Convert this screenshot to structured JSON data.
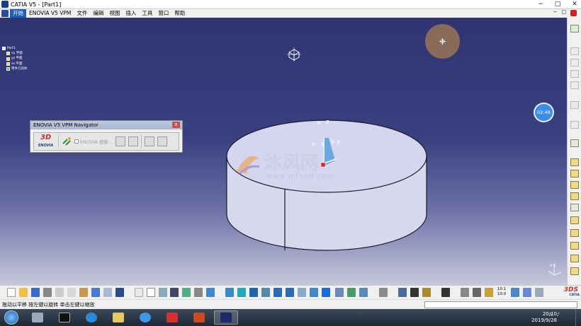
{
  "window": {
    "title": "CATIA V5 - [Part1]",
    "controls": [
      "−",
      "□",
      "✕"
    ]
  },
  "menu": {
    "items": [
      "开始",
      "ENOVIA V5 VPM",
      "文件",
      "编辑",
      "视图",
      "插入",
      "工具",
      "窗口",
      "帮助"
    ],
    "mdi_controls": [
      "−",
      "□"
    ]
  },
  "tree": {
    "root": "Part1",
    "children": [
      "xy 平面",
      "yz 平面",
      "zx 平面",
      "零件几何体"
    ]
  },
  "navigator": {
    "title": "ENOVIA V5 VPM Navigator",
    "close_label": "x",
    "logo_mark": "3D",
    "logo_text": "ENOVIA",
    "search_label": "ENOVIA 搜索..."
  },
  "viewport": {
    "axis_labels": {
      "z": "z",
      "v": "v",
      "u": "u",
      "x": "x",
      "y": "y"
    },
    "watermark_title": "沐风网",
    "watermark_url": "www.mfcad.com",
    "corner_axes": "x  z"
  },
  "clock_bubble": "02:48",
  "status": {
    "message": "拖动以平移  按左键以旋转  单击左键以缩放"
  },
  "bottom_toolbar": {
    "coord_readout": [
      "10.1",
      "10.0"
    ],
    "brand_mark": "3DS",
    "brand_text": "CATIA"
  },
  "taskbar": {
    "time": "20:10",
    "date": "2019/9/28",
    "tray_label": "A"
  },
  "colors": {
    "viewport_top": "#2f3472",
    "viewport_bottom": "#c7c8dc",
    "part_fill": "#d4d5ee",
    "part_side": "#d8d8ec",
    "menu_accent": "#1d5fb8"
  }
}
